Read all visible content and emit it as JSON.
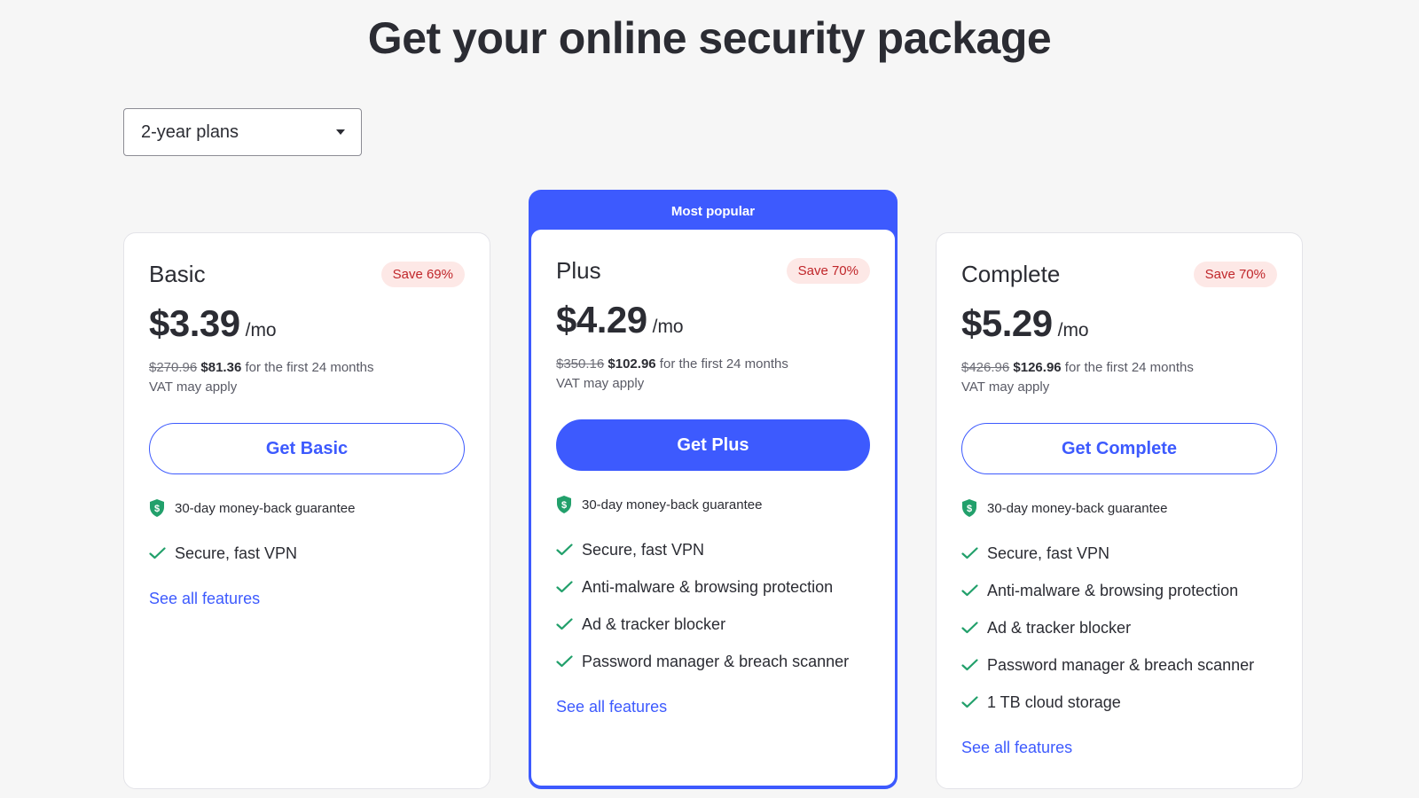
{
  "page": {
    "title": "Get your online security package"
  },
  "period_select": {
    "value": "2-year plans"
  },
  "colors": {
    "accent": "#3d5afe",
    "save_badge_bg": "#fde8e6",
    "save_badge_text": "#c0262a",
    "check": "#22a06b"
  },
  "icons": {
    "guarantee": "shield-check-icon",
    "feature": "check-icon",
    "dropdown": "caret-down-icon"
  },
  "plans": [
    {
      "name": "Basic",
      "badge": "Save 69%",
      "price": "$3.39",
      "per": "/mo",
      "old_price": "$270.96",
      "new_price": "$81.36",
      "period_text": " for the first 24 months",
      "vat": "VAT may apply",
      "cta": "Get Basic",
      "guarantee": "30-day money-back guarantee",
      "features": [
        "Secure, fast VPN"
      ],
      "see_all": "See all features"
    },
    {
      "name": "Plus",
      "ribbon": "Most popular",
      "badge": "Save 70%",
      "price": "$4.29",
      "per": "/mo",
      "old_price": "$350.16",
      "new_price": "$102.96",
      "period_text": " for the first 24 months",
      "vat": "VAT may apply",
      "cta": "Get Plus",
      "guarantee": "30-day money-back guarantee",
      "features": [
        "Secure, fast VPN",
        "Anti-malware & browsing protection",
        "Ad & tracker blocker",
        "Password manager & breach scanner"
      ],
      "see_all": "See all features"
    },
    {
      "name": "Complete",
      "badge": "Save 70%",
      "price": "$5.29",
      "per": "/mo",
      "old_price": "$426.96",
      "new_price": "$126.96",
      "period_text": " for the first 24 months",
      "vat": "VAT may apply",
      "cta": "Get Complete",
      "guarantee": "30-day money-back guarantee",
      "features": [
        "Secure, fast VPN",
        "Anti-malware & browsing protection",
        "Ad & tracker blocker",
        "Password manager & breach scanner",
        "1 TB cloud storage"
      ],
      "see_all": "See all features"
    }
  ]
}
